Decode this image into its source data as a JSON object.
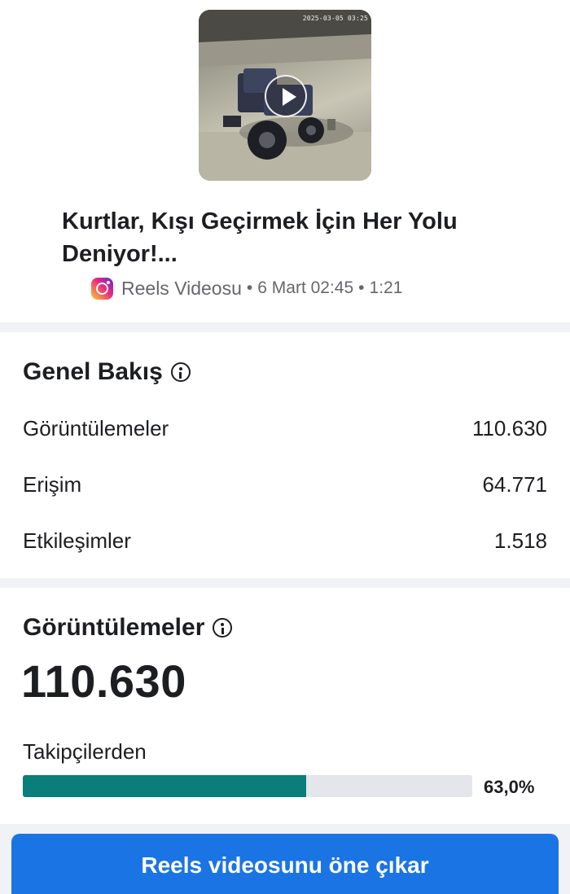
{
  "post": {
    "thumbnail_timestamp": "2025-03-05 03:25",
    "title": "Kurtlar, Kışı Geçirmek İçin Her Yolu Deniyor!...",
    "type_label": "Reels Videosu",
    "date": "6 Mart 02:45",
    "duration": "1:21",
    "separator": "•"
  },
  "overview": {
    "title": "Genel Bakış",
    "rows": [
      {
        "label": "Görüntülemeler",
        "value": "110.630"
      },
      {
        "label": "Erişim",
        "value": "64.771"
      },
      {
        "label": "Etkileşimler",
        "value": "1.518"
      }
    ]
  },
  "views": {
    "title": "Görüntülemeler",
    "total": "110.630",
    "followers_label": "Takipçilerden",
    "followers_percent_label": "63,0%",
    "followers_fraction": 0.63
  },
  "promote_button_label": "Reels videosunu öne çıkar",
  "colors": {
    "accent": "#1b74e4",
    "bar": "#0a7e78",
    "muted_text": "#65676b"
  }
}
